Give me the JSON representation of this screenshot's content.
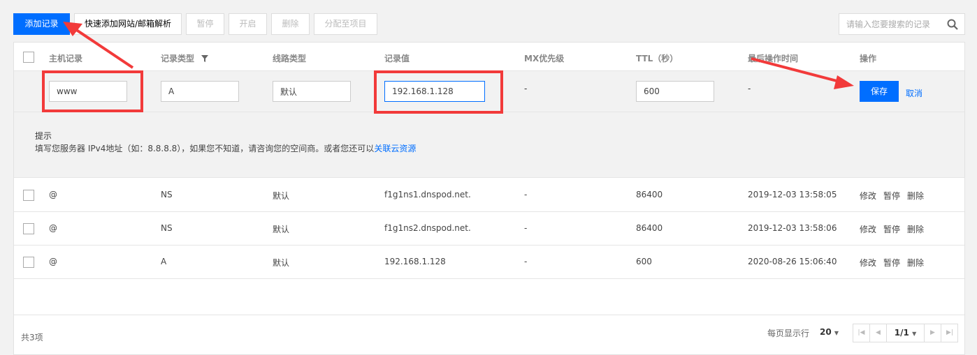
{
  "toolbar": {
    "add_label": "添加记录",
    "quick_add_label": "快速添加网站/邮箱解析",
    "pause_label": "暂停",
    "enable_label": "开启",
    "delete_label": "删除",
    "assign_label": "分配至项目"
  },
  "search": {
    "placeholder": "请输入您要搜索的记录",
    "icon": "search-icon"
  },
  "table": {
    "headers": {
      "host": "主机记录",
      "type": "记录类型",
      "line": "线路类型",
      "value": "记录值",
      "mx": "MX优先级",
      "ttl": "TTL（秒）",
      "time": "最后操作时间",
      "action": "操作"
    },
    "edit_row": {
      "host": "www",
      "type": "A",
      "line": "默认",
      "value": "192.168.1.128",
      "mx": "-",
      "ttl": "600",
      "time": "-",
      "save_label": "保存",
      "cancel_label": "取消"
    },
    "tip": {
      "title": "提示",
      "text": "填写您服务器 IPv4地址（如：8.8.8.8），如果您不知道，请咨询您的空间商。或者您还可以",
      "link": "关联云资源"
    },
    "rows": [
      {
        "host": "@",
        "type": "NS",
        "line": "默认",
        "value": "f1g1ns1.dnspod.net.",
        "mx": "-",
        "ttl": "86400",
        "time": "2019-12-03 13:58:05"
      },
      {
        "host": "@",
        "type": "NS",
        "line": "默认",
        "value": "f1g1ns2.dnspod.net.",
        "mx": "-",
        "ttl": "86400",
        "time": "2019-12-03 13:58:06"
      },
      {
        "host": "@",
        "type": "A",
        "line": "默认",
        "value": "192.168.1.128",
        "mx": "-",
        "ttl": "600",
        "time": "2020-08-26 15:06:40"
      }
    ],
    "row_actions": {
      "edit": "修改",
      "pause": "暂停",
      "delete": "删除"
    }
  },
  "footer": {
    "total": "共3项",
    "per_page_label": "每页显示行",
    "per_page_value": "20",
    "page": "1/1"
  },
  "colors": {
    "primary": "#006eff",
    "annotation": "#f23a3a"
  }
}
